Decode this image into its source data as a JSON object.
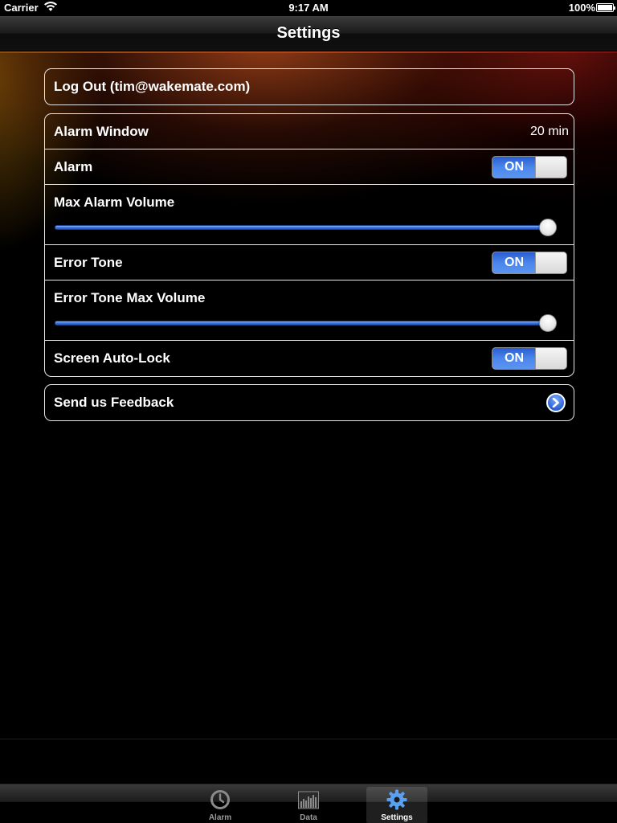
{
  "status_bar": {
    "carrier": "Carrier",
    "time": "9:17 AM",
    "battery": "100%"
  },
  "nav": {
    "title": "Settings"
  },
  "account": {
    "logout_label": "Log Out (tim@wakemate.com)"
  },
  "settings": {
    "alarm_window": {
      "label": "Alarm Window",
      "value": "20 min"
    },
    "alarm": {
      "label": "Alarm",
      "state": "ON"
    },
    "max_alarm_volume": {
      "label": "Max Alarm Volume",
      "level": 1.0
    },
    "error_tone": {
      "label": "Error Tone",
      "state": "ON"
    },
    "error_tone_max_volume": {
      "label": "Error Tone Max Volume",
      "level": 1.0
    },
    "screen_auto_lock": {
      "label": "Screen Auto-Lock",
      "state": "ON"
    }
  },
  "feedback": {
    "label": "Send us Feedback"
  },
  "tabs": [
    {
      "label": "Alarm",
      "icon": "clock-icon",
      "selected": false
    },
    {
      "label": "Data",
      "icon": "bar-chart-icon",
      "selected": false
    },
    {
      "label": "Settings",
      "icon": "gear-icon",
      "selected": true
    }
  ],
  "colors": {
    "accent_blue": "#3d74de",
    "selected_tab_icon": "#5aa0f0",
    "unselected_tab_icon": "#8a8a8a"
  }
}
